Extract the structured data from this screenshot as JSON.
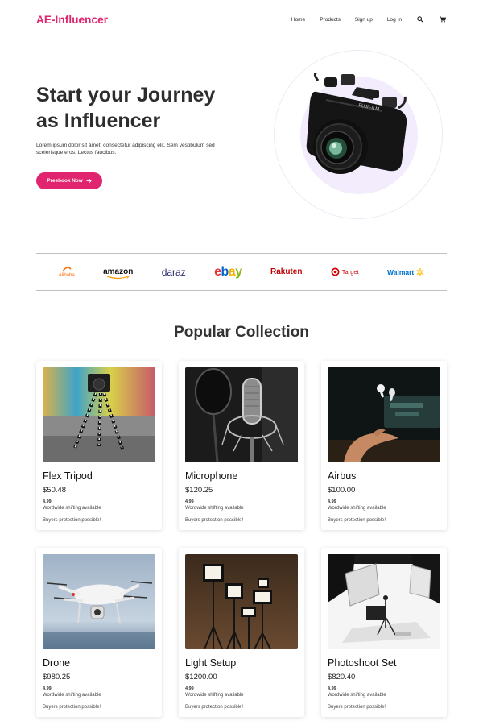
{
  "brand": {
    "name": "AE-Influencer",
    "accent": "#e0246e"
  },
  "nav": {
    "links": [
      "Home",
      "Products",
      "Sign up",
      "Log In"
    ],
    "icons": [
      "search-icon",
      "cart-icon"
    ]
  },
  "hero": {
    "title_line1": "Start your Journey",
    "title_line2": "as Influencer",
    "description": "Lorem ipsum dolor sit amet, consectetur adipiscing elit. Sem vestibulum sed scelerisque eros. Lectus faucibus.",
    "cta_label": "Preebook Now",
    "image": "camera"
  },
  "brands": {
    "alibaba": "Alibaba",
    "amazon": "amazon",
    "daraz": "daraz",
    "ebay": [
      "e",
      "b",
      "a",
      "y"
    ],
    "rakuten": "Rakuten",
    "target": "Target",
    "walmart": "Walmart"
  },
  "collection": {
    "title": "Popular Collection",
    "products": [
      {
        "name": "Flex Tripod",
        "price": "$50.48",
        "rating": "4.99",
        "shipping": "Wordwide shifting available",
        "protection": "Buyers protection possible!"
      },
      {
        "name": "Microphone",
        "price": "$120.25",
        "rating": "4.99",
        "shipping": "Wordwide shifting available",
        "protection": "Buyers protection possible!"
      },
      {
        "name": "Airbus",
        "price": "$100.00",
        "rating": "4.99",
        "shipping": "Wordwide shifting available",
        "protection": "Buyers protection possible!"
      },
      {
        "name": "Drone",
        "price": "$980.25",
        "rating": "4.99",
        "shipping": "Wordwide shifting available",
        "protection": "Buyers protection possible!"
      },
      {
        "name": "Light Setup",
        "price": "$1200.00",
        "rating": "4.99",
        "shipping": "Wordwide shifting available",
        "protection": "Buyers protection possible!"
      },
      {
        "name": "Photoshoot Set",
        "price": "$820.40",
        "rating": "4.99",
        "shipping": "Wordwide shifting available",
        "protection": "Buyers protection possible!"
      }
    ]
  }
}
